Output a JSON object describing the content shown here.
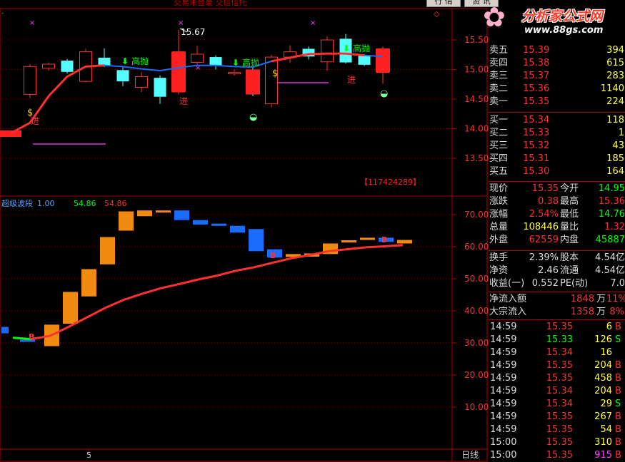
{
  "topbar": {
    "title": "交易未登录  交信信托",
    "btn_quote": "行 情",
    "btn_info": "资 讯"
  },
  "logo": {
    "text": "分析家公式网",
    "url": "www.88gs.com"
  },
  "colors": {
    "red": "#ff3030",
    "cyan": "#54ffff",
    "blue": "#1a6cff",
    "orange": "#f08a10",
    "green": "#00ff00",
    "white": "#ffffff"
  },
  "price_chart": {
    "high_label": "15.67",
    "signal_sell": "高抛",
    "signal_buy": "进",
    "code_badge": "【117424289】",
    "y_ticks": [
      "15.50",
      "15.00",
      "14.50",
      "14.00",
      "13.50"
    ],
    "candles": [
      {
        "o": 13.93,
        "c": 13.93,
        "h": 13.95,
        "l": 13.88,
        "col": "red"
      },
      {
        "o": 14.58,
        "c": 15.05,
        "h": 15.09,
        "l": 14.52,
        "col": "red"
      },
      {
        "o": 15.02,
        "c": 15.09,
        "h": 15.12,
        "l": 14.98,
        "col": "red"
      },
      {
        "o": 15.15,
        "c": 14.96,
        "h": 15.18,
        "l": 14.93,
        "col": "cyan"
      },
      {
        "o": 14.8,
        "c": 15.3,
        "h": 15.35,
        "l": 14.78,
        "col": "red"
      },
      {
        "o": 15.2,
        "c": 15.06,
        "h": 15.36,
        "l": 15.04,
        "col": "cyan"
      },
      {
        "o": 14.99,
        "c": 14.8,
        "h": 15.04,
        "l": 14.72,
        "col": "cyan"
      },
      {
        "o": 14.7,
        "c": 14.88,
        "h": 14.96,
        "l": 14.62,
        "col": "red"
      },
      {
        "o": 14.86,
        "c": 14.54,
        "h": 14.9,
        "l": 14.42,
        "col": "cyan"
      },
      {
        "o": 14.62,
        "c": 15.3,
        "h": 15.67,
        "l": 14.58,
        "col": "red"
      },
      {
        "o": 15.12,
        "c": 15.26,
        "h": 15.4,
        "l": 15.07,
        "col": "red"
      },
      {
        "o": 15.21,
        "c": 15.06,
        "h": 15.24,
        "l": 15.0,
        "col": "cyan"
      },
      {
        "o": 14.95,
        "c": 14.95,
        "h": 15.0,
        "l": 14.9,
        "col": "red"
      },
      {
        "o": 15.0,
        "c": 14.58,
        "h": 15.06,
        "l": 14.55,
        "col": "cyan"
      },
      {
        "o": 14.42,
        "c": 15.21,
        "h": 15.25,
        "l": 14.36,
        "col": "red"
      },
      {
        "o": 15.21,
        "c": 15.3,
        "h": 15.41,
        "l": 15.11,
        "col": "red"
      },
      {
        "o": 15.35,
        "c": 15.22,
        "h": 15.39,
        "l": 15.17,
        "col": "cyan"
      },
      {
        "o": 15.13,
        "c": 15.5,
        "h": 15.56,
        "l": 14.98,
        "col": "red"
      },
      {
        "o": 15.12,
        "c": 15.52,
        "h": 15.6,
        "l": 15.1,
        "col": "cyan"
      },
      {
        "o": 15.24,
        "c": 15.08,
        "h": 15.26,
        "l": 15.06,
        "col": "cyan"
      },
      {
        "o": 15.35,
        "c": 14.95,
        "h": 15.39,
        "l": 14.76,
        "col": "red"
      }
    ],
    "ma_line": [
      13.93,
      14.1,
      14.55,
      14.88,
      15.05,
      15.07,
      15.05,
      15.01,
      14.98,
      15.03,
      15.07,
      15.07,
      15.05,
      15.04,
      15.14,
      15.2,
      15.26,
      15.27,
      15.27,
      15.24,
      15.22
    ]
  },
  "indicator_chart": {
    "title": "超级波段",
    "value_a": "1.00",
    "value_b": "54.86",
    "value_c": "54.86",
    "y_ticks": [
      "70.00",
      "60.00",
      "50.00",
      "40.00",
      "30.00",
      "20.00",
      "10.00"
    ],
    "bars": [
      {
        "a": 35.0,
        "b": 33.0,
        "col": "blue"
      },
      {
        "a": 31.0,
        "b": 30.6,
        "col": "blue"
      },
      {
        "a": 29.0,
        "b": 35.7,
        "col": "orange"
      },
      {
        "a": 36.0,
        "b": 45.9,
        "col": "orange"
      },
      {
        "a": 44.5,
        "b": 53.0,
        "col": "orange"
      },
      {
        "a": 54.5,
        "b": 63.0,
        "col": "orange"
      },
      {
        "a": 65.0,
        "b": 71.0,
        "col": "orange"
      },
      {
        "a": 69.5,
        "b": 71.3,
        "col": "orange"
      },
      {
        "a": 71.3,
        "b": 70.9,
        "col": "orange"
      },
      {
        "a": 71.3,
        "b": 68.3,
        "col": "blue"
      },
      {
        "a": 68.3,
        "b": 66.9,
        "col": "blue"
      },
      {
        "a": 67.2,
        "b": 66.5,
        "col": "blue"
      },
      {
        "a": 66.5,
        "b": 64.4,
        "col": "blue"
      },
      {
        "a": 65.5,
        "b": 58.6,
        "col": "blue"
      },
      {
        "a": 59.2,
        "b": 56.6,
        "col": "blue"
      },
      {
        "a": 56.8,
        "b": 57.7,
        "col": "orange"
      },
      {
        "a": 56.9,
        "b": 57.9,
        "col": "orange"
      },
      {
        "a": 57.7,
        "b": 61.0,
        "col": "orange"
      },
      {
        "a": 61.3,
        "b": 62.0,
        "col": "orange"
      },
      {
        "a": 62.1,
        "b": 62.8,
        "col": "orange"
      },
      {
        "a": 62.8,
        "b": 61.5,
        "col": "blue"
      },
      {
        "a": 61.0,
        "b": 62.1,
        "col": "orange"
      }
    ],
    "line": [
      31.6,
      31.2,
      32.2,
      35.0,
      38.0,
      41.0,
      43.5,
      45.4,
      47.1,
      48.4,
      49.8,
      51.0,
      52.5,
      53.6,
      55.0,
      56.4,
      57.4,
      58.6,
      59.2,
      59.8,
      60.1,
      60.5
    ],
    "marker": "B",
    "day_label": "5",
    "period": "日线"
  },
  "quote_panel": {
    "asks": [
      {
        "label": "卖五",
        "price": "15.39",
        "vol": "394"
      },
      {
        "label": "卖四",
        "price": "15.38",
        "vol": "615"
      },
      {
        "label": "卖三",
        "price": "15.37",
        "vol": "283"
      },
      {
        "label": "卖二",
        "price": "15.36",
        "vol": "1140"
      },
      {
        "label": "卖一",
        "price": "15.35",
        "vol": "224"
      }
    ],
    "bids": [
      {
        "label": "买一",
        "price": "15.34",
        "vol": "118"
      },
      {
        "label": "买二",
        "price": "15.33",
        "vol": "1"
      },
      {
        "label": "买三",
        "price": "15.32",
        "vol": "43"
      },
      {
        "label": "买四",
        "price": "15.31",
        "vol": "185"
      },
      {
        "label": "买五",
        "price": "15.30",
        "vol": "164"
      }
    ],
    "stats": [
      {
        "l1": "现价",
        "v1": "15.35",
        "l2": "今开",
        "v2": "14.95"
      },
      {
        "l1": "涨跌",
        "v1": "0.38",
        "l2": "最高",
        "v2": "15.36"
      },
      {
        "l1": "涨幅",
        "v1": "2.54%",
        "l2": "最低",
        "v2": "14.76"
      },
      {
        "l1": "总量",
        "v1": "108446",
        "l2": "量比",
        "v2": "1.32"
      },
      {
        "l1": "外盘",
        "v1": "62559",
        "l2": "内盘",
        "v2": "45887"
      },
      {
        "l1": "换手",
        "v1": "2.39%",
        "l2": "股本",
        "v2": "4.54亿"
      },
      {
        "l1": "净资",
        "v1": "2.46",
        "l2": "流通",
        "v2": "4.54亿"
      },
      {
        "l1": "收益(一)",
        "v1": "0.552",
        "l2": "PE(动)",
        "v2": "7.0"
      }
    ],
    "flow": [
      {
        "label": "净流入额",
        "value": "1848",
        "unit": "万",
        "pct": "11%"
      },
      {
        "label": "大宗流入",
        "value": "1358",
        "unit": "万",
        "pct": "8%"
      }
    ],
    "ticks": [
      {
        "time": "14:59",
        "price": "15.35",
        "vol": "6",
        "side": "B"
      },
      {
        "time": "14:59",
        "price": "15.33",
        "vol": "126",
        "side": "S"
      },
      {
        "time": "14:59",
        "price": "15.34",
        "vol": "16",
        "side": ""
      },
      {
        "time": "14:59",
        "price": "15.35",
        "vol": "204",
        "side": "B"
      },
      {
        "time": "14:59",
        "price": "15.35",
        "vol": "458",
        "side": "B"
      },
      {
        "time": "14:59",
        "price": "15.34",
        "vol": "204",
        "side": "B"
      },
      {
        "time": "14:59",
        "price": "15.34",
        "vol": "29",
        "side": "S"
      },
      {
        "time": "14:59",
        "price": "15.35",
        "vol": "267",
        "side": "B"
      },
      {
        "time": "14:59",
        "price": "15.35",
        "vol": "54",
        "side": "B"
      },
      {
        "time": "15:00",
        "price": "15.35",
        "vol": "310",
        "side": "B"
      },
      {
        "time": "15:00",
        "price": "15.35",
        "vol": "915",
        "side": "B"
      }
    ]
  }
}
